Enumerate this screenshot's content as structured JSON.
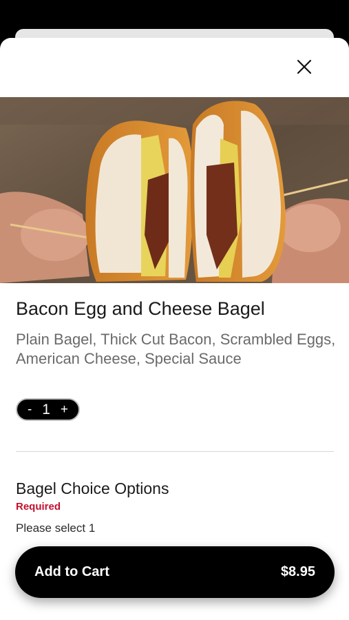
{
  "item": {
    "title": "Bacon Egg and Cheese Bagel",
    "description": "Plain Bagel, Thick Cut Bacon, Scrambled Eggs, American Cheese, Special Sauce"
  },
  "quantity": {
    "decrement": "-",
    "value": "1",
    "increment": "+"
  },
  "options": {
    "title": "Bagel Choice Options",
    "required_label": "Required",
    "hint": "Please select 1"
  },
  "cart": {
    "label": "Add to Cart",
    "price": "$8.95"
  },
  "icons": {
    "close": "close-icon"
  },
  "colors": {
    "accent_required": "#c2102f",
    "button_bg": "#000000"
  }
}
